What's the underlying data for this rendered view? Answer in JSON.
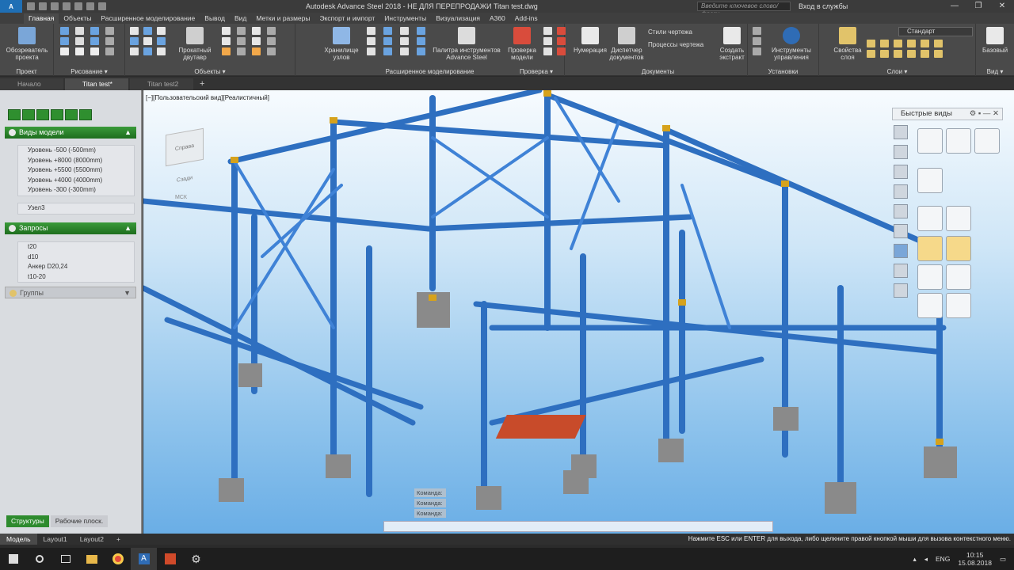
{
  "titlebar": {
    "app_button": "A",
    "title": "Autodesk Advance Steel 2018 - НЕ ДЛЯ ПЕРЕПРОДАЖИ    Titan test.dwg",
    "search_placeholder": "Введите ключевое слово/фразу",
    "login": "Вход в службы",
    "minimize": "—",
    "maximize": "❐",
    "close": "✕"
  },
  "ribbon_tabs": [
    "Главная",
    "Объекты",
    "Расширенное моделирование",
    "Вывод",
    "Вид",
    "Метки и размеры",
    "Экспорт и импорт",
    "Инструменты",
    "Визуализация",
    "A360",
    "Add-ins"
  ],
  "ribbon": {
    "project_btn": "Обозреватель проекта",
    "hollow_btn": "Прокатный двутавр",
    "storage_btn": "Хранилище узлов",
    "palette_btn": "Палитра инструментов Advance Steel",
    "check_btn": "Проверка модели",
    "numbering_btn": "Нумерация",
    "docs_btn": "Диспетчер документов",
    "styles_link": "Стили чертежа",
    "processes_link": "Процессы чертежа",
    "extract_btn": "Создать экстракт",
    "tools_btn": "Инструменты управления",
    "layers_btn": "Свойства слоя",
    "layer_select": "Стандарт",
    "base_btn": "Базовый",
    "panels": [
      "Проект",
      "Рисование ▾",
      "Объекты ▾",
      "Расширенное моделирование",
      "Проверка ▾",
      "Документы",
      "Установки",
      "Слои ▾",
      "Вид ▾"
    ]
  },
  "doc_tabs": [
    "Начало",
    "Titan test*",
    "Titan test2"
  ],
  "left_panel": {
    "section_views": "Виды модели",
    "views": [
      "Уровень -500 (-500mm)",
      "Уровень +8000 (8000mm)",
      "Уровень +5500 (5500mm)",
      "Уровень +4000 (4000mm)",
      "Уровень -300 (-300mm)"
    ],
    "node": "Узел3",
    "section_queries": "Запросы",
    "queries": [
      "t20",
      "d10",
      "Анкер D20,24",
      "t10-20"
    ],
    "section_groups": "Группы",
    "tab_structures": "Структуры",
    "tab_workplanes": "Рабочие плоск."
  },
  "viewport": {
    "label": "[−][Пользовательский вид][Реалистичный]",
    "viewcube": "Справа  Сзади",
    "ucs": "МСК",
    "quick_views_title": "Быстрые виды",
    "command_lines": [
      "Команда:",
      "Команда:",
      "Команда:"
    ]
  },
  "layout_tabs": [
    "Модель",
    "Layout1",
    "Layout2"
  ],
  "status_message": "Нажмите ESC или ENTER для выхода, либо щелкните правой кнопкой мыши для вызова контекстного меню.",
  "taskbar": {
    "lang": "ENG",
    "time": "10:15",
    "date": "15.08.2018"
  },
  "colors": {
    "steel_blue": "#2e6fc0",
    "ribbon_bg": "#4a4a4a",
    "panel_green": "#2e8b2e"
  }
}
